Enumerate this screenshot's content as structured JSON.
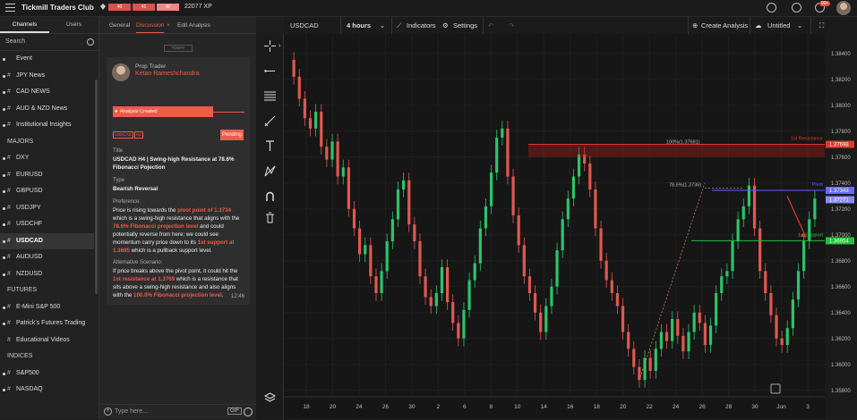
{
  "app": {
    "title": "Tickmill Traders Club",
    "xp": "22077 XP",
    "xp_levels": [
      "40",
      "41",
      "42"
    ],
    "notifications": "99+"
  },
  "left": {
    "tabs": [
      "Channels",
      "Users"
    ],
    "search_placeholder": "Search",
    "items": [
      {
        "kind": "channel",
        "label": "Event",
        "dot": true,
        "hash": false
      },
      {
        "kind": "channel",
        "label": "JPY News",
        "dot": true,
        "hash": true
      },
      {
        "kind": "channel",
        "label": "CAD NEWS",
        "dot": true,
        "hash": true
      },
      {
        "kind": "channel",
        "label": "AUD & NZD News",
        "dot": true,
        "hash": true
      },
      {
        "kind": "channel",
        "label": "Institutional Insights",
        "dot": true,
        "hash": true
      },
      {
        "kind": "section",
        "label": "MAJORS"
      },
      {
        "kind": "channel",
        "label": "DXY",
        "dot": true,
        "hash": true
      },
      {
        "kind": "channel",
        "label": "EURUSD",
        "dot": true,
        "hash": true
      },
      {
        "kind": "channel",
        "label": "GBPUSD",
        "dot": true,
        "hash": true
      },
      {
        "kind": "channel",
        "label": "USDJPY",
        "dot": true,
        "hash": true
      },
      {
        "kind": "channel",
        "label": "USDCHF",
        "dot": true,
        "hash": true
      },
      {
        "kind": "channel",
        "label": "USDCAD",
        "dot": true,
        "hash": true,
        "selected": true
      },
      {
        "kind": "channel",
        "label": "AUDUSD",
        "dot": true,
        "hash": true
      },
      {
        "kind": "channel",
        "label": "NZDUSD",
        "dot": true,
        "hash": true
      },
      {
        "kind": "section",
        "label": "FUTURES"
      },
      {
        "kind": "channel",
        "label": "E-Mini S&P 500",
        "dot": true,
        "hash": true
      },
      {
        "kind": "channel",
        "label": "Patrick's Futures Trading",
        "dot": true,
        "hash": true
      },
      {
        "kind": "channel",
        "label": "Educational Videos",
        "dot": false,
        "hash": true
      },
      {
        "kind": "section",
        "label": "INDICES"
      },
      {
        "kind": "channel",
        "label": "S&P500",
        "dot": true,
        "hash": true
      },
      {
        "kind": "channel",
        "label": "NASDAQ",
        "dot": true,
        "hash": true
      }
    ]
  },
  "mid": {
    "tabs": {
      "general": "General",
      "discussion": "Discussion",
      "close": "×",
      "edit": "Edit Analysis"
    },
    "today": "TODAY",
    "author_role": "Prop Trader",
    "author_name": "Ketan Rameshchandra",
    "status_created": "Analysis Created",
    "tags": [
      "USDCAD",
      "H4"
    ],
    "pending": "Pending",
    "title_label": "Title",
    "title_value": "USDCAD H4 | Swing-high Resistance at 78.6% Fibonacci Pojection",
    "type_label": "Type",
    "type_value": "Bearish Reversal",
    "pref_label": "Preference:",
    "pref": [
      "Price is rising towards the ",
      "pivot point of 1.3734",
      " which is a swing-high resistance that aligns with the ",
      "78.6% Fibonacci projection level",
      " and could potentially reverse from here; we could see momentum carry price down to its ",
      "1st support at 1.3695",
      " which is a pullback support level."
    ],
    "alt_label": "Alternative Scenario:",
    "alt": [
      "If price breaks above the pivot point, it could hit the ",
      "1st resistance at 1.3769",
      " which is a resistance that sits above a swing-high resistance and also aligns with the ",
      "100.0% Fibonacci projection level",
      "."
    ],
    "time": "12:46",
    "type_placeholder": "Type here...",
    "gif": "GIF"
  },
  "chart_header": {
    "symbol": "USDCAD",
    "interval": "4 hours",
    "indicators": "Indicators",
    "settings": "Settings",
    "create": "Create Analysis",
    "untitled": "Untitled"
  },
  "chart_data": {
    "type": "candlestick",
    "symbol": "USDCAD",
    "interval": "4 hours",
    "ylim": [
      1.3575,
      1.3855
    ],
    "y_ticks": [
      "1.38400",
      "1.38200",
      "1.38000",
      "1.37800",
      "1.37600",
      "1.37400",
      "1.37200",
      "1.37000",
      "1.36800",
      "1.36600",
      "1.36400",
      "1.36200",
      "1.36000",
      "1.35800"
    ],
    "x_ticks": [
      "18",
      "20",
      "24",
      "26",
      "30",
      "2",
      "6",
      "8",
      "10",
      "14",
      "16",
      "18",
      "20",
      "22",
      "24",
      "26",
      "28",
      "30",
      "Jun",
      "3"
    ],
    "levels": [
      {
        "name": "1st Resistance",
        "price": 1.37698,
        "label": "1.37698",
        "color": "#e0392f"
      },
      {
        "name": "Pivot",
        "price": 1.37343,
        "label": "1.37343",
        "color": "#6060ff"
      },
      {
        "name": "1st Support",
        "price": 1.36954,
        "label": "1.36954",
        "color": "#22c23a"
      }
    ],
    "fib_labels": [
      {
        "text": "100%(1.37691)",
        "price": 1.37691
      },
      {
        "text": "78.6%(1.3736)",
        "price": 1.3736
      }
    ],
    "current_price": "1.37271",
    "close_series": [
      1.3835,
      1.3822,
      1.3805,
      1.379,
      1.3782,
      1.3795,
      1.3768,
      1.3758,
      1.3772,
      1.3745,
      1.3752,
      1.372,
      1.3705,
      1.3685,
      1.3692,
      1.3668,
      1.3655,
      1.3672,
      1.3695,
      1.3712,
      1.3735,
      1.3742,
      1.3708,
      1.3695,
      1.3668,
      1.3652,
      1.3645,
      1.3655,
      1.3675,
      1.3648,
      1.3632,
      1.362,
      1.3642,
      1.3665,
      1.3678,
      1.3705,
      1.3722,
      1.3748,
      1.3775,
      1.3782,
      1.3745,
      1.3715,
      1.3692,
      1.3668,
      1.3655,
      1.364,
      1.3625,
      1.3645,
      1.366,
      1.3688,
      1.3712,
      1.3728,
      1.3745,
      1.3762,
      1.3755,
      1.3735,
      1.3705,
      1.368,
      1.3665,
      1.3655,
      1.3645,
      1.3625,
      1.3612,
      1.3598,
      1.3588,
      1.3605,
      1.3595,
      1.3612,
      1.3625,
      1.3618,
      1.3635,
      1.3622,
      1.361,
      1.3625,
      1.364,
      1.3632,
      1.3615,
      1.363,
      1.3655,
      1.3668,
      1.3672,
      1.3695,
      1.3712,
      1.3722,
      1.3738,
      1.3705,
      1.3672,
      1.3655,
      1.3638,
      1.362,
      1.3615,
      1.3628,
      1.365,
      1.3672,
      1.3695,
      1.3712,
      1.3728
    ]
  }
}
